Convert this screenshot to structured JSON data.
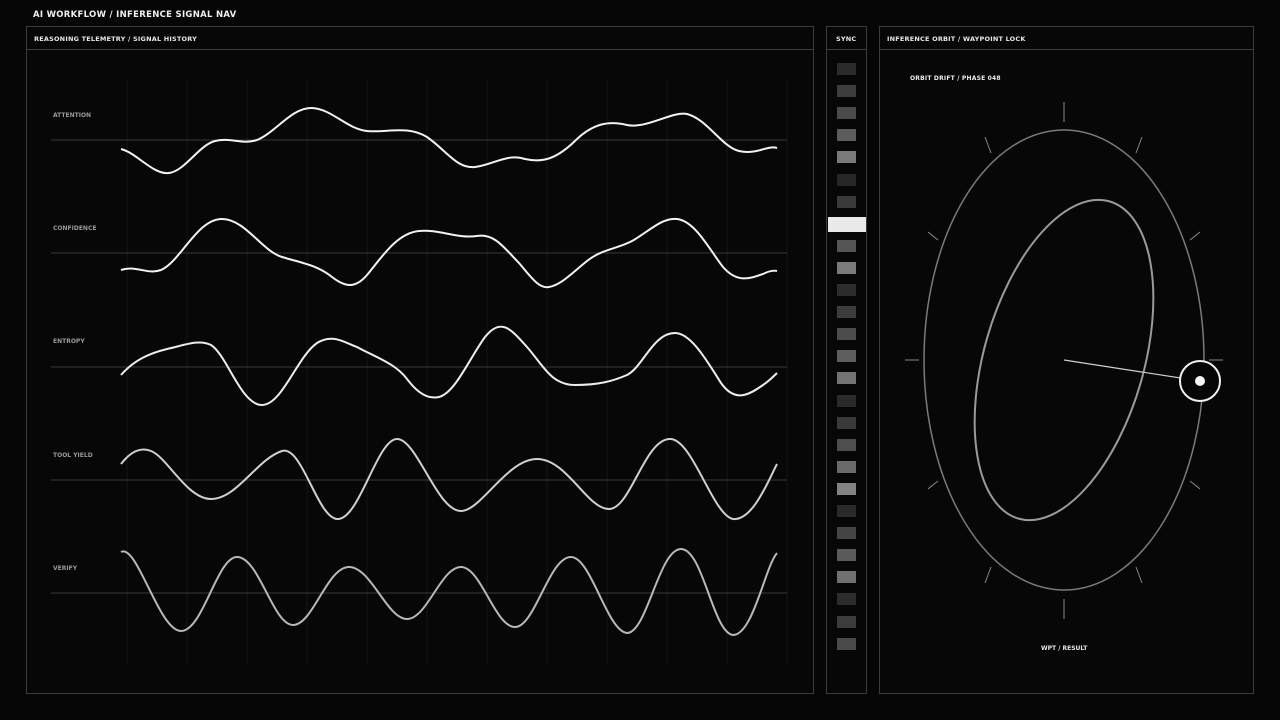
{
  "app_title": "AI WORKFLOW / INFERENCE SIGNAL NAV",
  "telemetry": {
    "title": "REASONING TELEMETRY / SIGNAL HISTORY",
    "signals": [
      {
        "label": "ATTENTION"
      },
      {
        "label": "CONFIDENCE"
      },
      {
        "label": "ENTROPY"
      },
      {
        "label": "TOOL YIELD"
      },
      {
        "label": "VERIFY"
      }
    ]
  },
  "sync": {
    "title": "SYNC",
    "active_index": 7,
    "cells": [
      "#2a2a2a",
      "#3d3d3d",
      "#4a4a4a",
      "#5c5c5c",
      "#7a7a7a",
      "#262626",
      "#3a3a3a",
      "#e9e9e9",
      "#555555",
      "#7a7a7a",
      "#2c2c2c",
      "#3c3c3c",
      "#4c4c4c",
      "#5e5e5e",
      "#737373",
      "#2a2a2a",
      "#3a3a3a",
      "#4e4e4e",
      "#6a6a6a",
      "#838383",
      "#2a2a2a",
      "#444444",
      "#5a5a5a",
      "#717171",
      "#2c2c2c",
      "#3c3c3c",
      "#4a4a4a"
    ]
  },
  "orbit": {
    "title": "INFERENCE ORBIT / WAYPOINT LOCK",
    "subtitle": "ORBIT DRIFT / PHASE 048",
    "result_label": "WPT / RESULT"
  },
  "colors": {
    "background": "#060606",
    "border": "#3c3c3c",
    "wave_bright": "#f2f2f2",
    "wave_dim": "#b8b8b8"
  }
}
